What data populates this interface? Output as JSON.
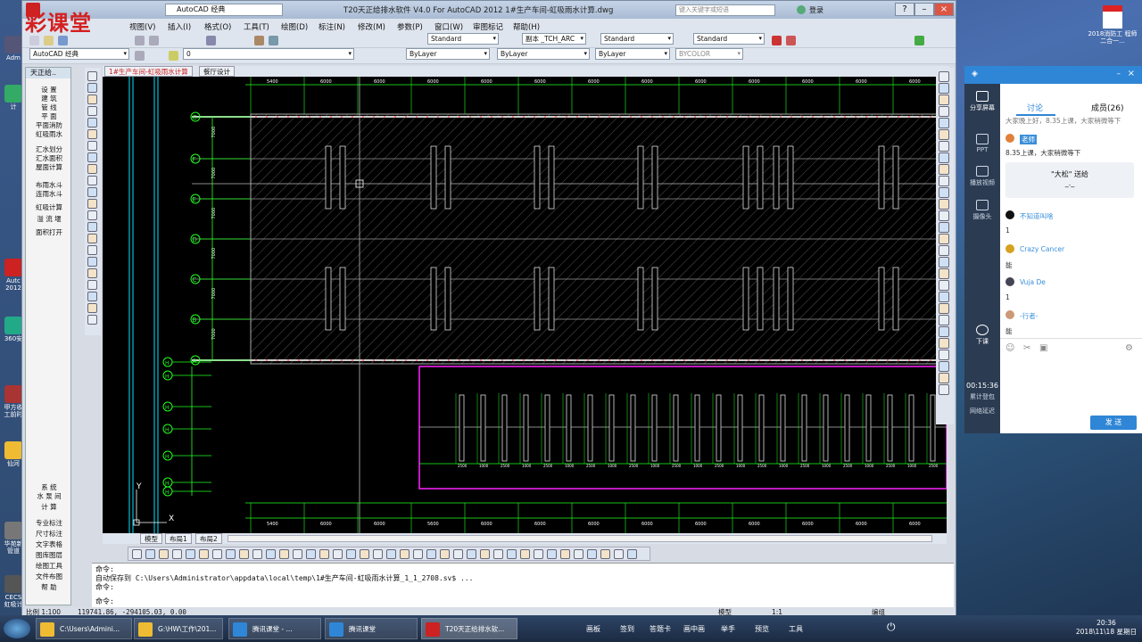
{
  "app": {
    "title": "T20天正给排水软件 V4.0 For AutoCAD 2012    1#生产车间-虹吸雨水计算.dwg",
    "workspace": "AutoCAD 经典",
    "search_placeholder": "键入关键字或短语",
    "login": "登录"
  },
  "watermark": "彩课堂",
  "menu": [
    "视图(V)",
    "插入(I)",
    "格式(O)",
    "工具(T)",
    "绘图(D)",
    "标注(N)",
    "修改(M)",
    "参数(P)",
    "窗口(W)",
    "审图标记",
    "帮助(H)"
  ],
  "toolbar": {
    "text_style": "Standard",
    "dim_style": "副本 _TCH_ARC",
    "table_style": "Standard",
    "ml_style": "Standard",
    "workspace_combo": "AutoCAD 经典",
    "layer": "0",
    "color": "ByLayer",
    "linetype": "ByLayer",
    "lineweight": "ByLayer",
    "plotstyle": "BYCOLOR"
  },
  "tz_menu": {
    "header": "天正给..",
    "items": [
      "设 置",
      "建 筑",
      "管 线",
      "平 面",
      "平面消防",
      "虹吸雨水",
      "汇水划分",
      "汇水面积",
      "屋面计算",
      "布雨水斗",
      "连雨水斗",
      "虹吸计算",
      "溢 流 堰",
      "面积打开",
      "系 统",
      "水 泵 间",
      "计 算",
      "专业标注",
      "尺寸标注",
      "文字表格",
      "图库图层",
      "绘图工具",
      "文件布图",
      "帮 助"
    ]
  },
  "drawing_tabs": [
    "1#生产车间-虹吸雨水计算",
    "餐厅设计"
  ],
  "layout_tabs": [
    "模型",
    "布局1",
    "布局2"
  ],
  "axes": {
    "rows": [
      "G",
      "F",
      "E",
      "D",
      "C",
      "B",
      "A"
    ],
    "left_marks": [
      "H",
      "H",
      "H",
      "H",
      "H",
      "H",
      "H"
    ],
    "top_dims": [
      "5400",
      "6000",
      "6000",
      "6000",
      "6000",
      "6000",
      "6000",
      "6000",
      "6000",
      "6000",
      "6000",
      "6000",
      "6000"
    ],
    "row_dims": [
      "7000",
      "7000",
      "7000",
      "7000",
      "7000",
      "7000"
    ],
    "bottom_dims": [
      "5400",
      "6000",
      "6000",
      "5600",
      "6000",
      "6000",
      "6000",
      "6000",
      "6000",
      "6000",
      "6000",
      "6000",
      "6000"
    ],
    "sub_dims": [
      "2500",
      "1000",
      "2500",
      "1000",
      "2500",
      "1000",
      "2500",
      "1000",
      "2500",
      "1000",
      "2500",
      "1000",
      "2500",
      "1000",
      "2500",
      "1000",
      "2500",
      "1000",
      "2500",
      "1000",
      "2500",
      "1000",
      "2500"
    ]
  },
  "ucs": {
    "y": "Y",
    "x": "X"
  },
  "command": {
    "lines": [
      "命令:",
      "自动保存到 C:\\Users\\Administrator\\appdata\\local\\temp\\1#生产车间-虹吸雨水计算_1_1_2708.sv$ ...",
      "命令:",
      "命令:"
    ]
  },
  "status": {
    "scale": "比例 1:100",
    "coords": "119741.86, -294105.03, 0.00",
    "model": "模型",
    "annotation_scale": "1:1",
    "edit": "编组"
  },
  "tencent": {
    "tabs": [
      "讨论",
      "成员(26)"
    ],
    "side": [
      "分享屏幕",
      "PPT",
      "播放视频",
      "摄像头",
      "下课"
    ],
    "timer": "00:15:36",
    "timer_label": "累计登包",
    "net_label": "网络延迟",
    "messages": [
      {
        "type": "text",
        "text": "大家晚上好，8.35上课，大家稍微等下",
        "y": 0
      },
      {
        "type": "nick",
        "nick": "老师",
        "text": "8.35上课，大家稍微等下",
        "color": "#e0803a"
      },
      {
        "type": "gift",
        "title": "\"大松\" 送给",
        "sub": "_._"
      },
      {
        "type": "nick",
        "nick": "不知道叫啥",
        "text": "1",
        "color": "#111"
      },
      {
        "type": "nick",
        "nick": "Crazy Cancer",
        "text": "能",
        "color": "#d6a020"
      },
      {
        "type": "nick",
        "nick": "Vuja De",
        "text": "1",
        "color": "#445"
      },
      {
        "type": "nick",
        "nick": "-行者-",
        "text": "能",
        "color": "#c97"
      }
    ],
    "send": "发 送"
  },
  "taskbar": {
    "tasks": [
      "C:\\Users\\Admini...",
      "G:\\HW\\工作\\201...",
      "腾讯课堂 - ...",
      "腾讯课堂",
      "T20天正给排水软..."
    ],
    "tools": [
      "画板",
      "签到",
      "答题卡",
      "画中画",
      "举手",
      "预览",
      "工具"
    ],
    "time": "20:36",
    "date": "2018\\11\\18 星期日"
  },
  "desktop": {
    "left_icons": [
      "Adm",
      "计",
      "Autc 2012",
      "360安",
      "甲方收 工前时",
      "仙河",
      "华苑新 管道",
      "CECS 虹吸计"
    ],
    "right_icon": "2018消防工 程师二合一..."
  },
  "colors": {
    "accent": "#2f86d6",
    "cad_bg": "#000000",
    "grid_green": "#22ff22",
    "grid_cyan": "#00e5ff",
    "magenta": "#ff22ff"
  }
}
